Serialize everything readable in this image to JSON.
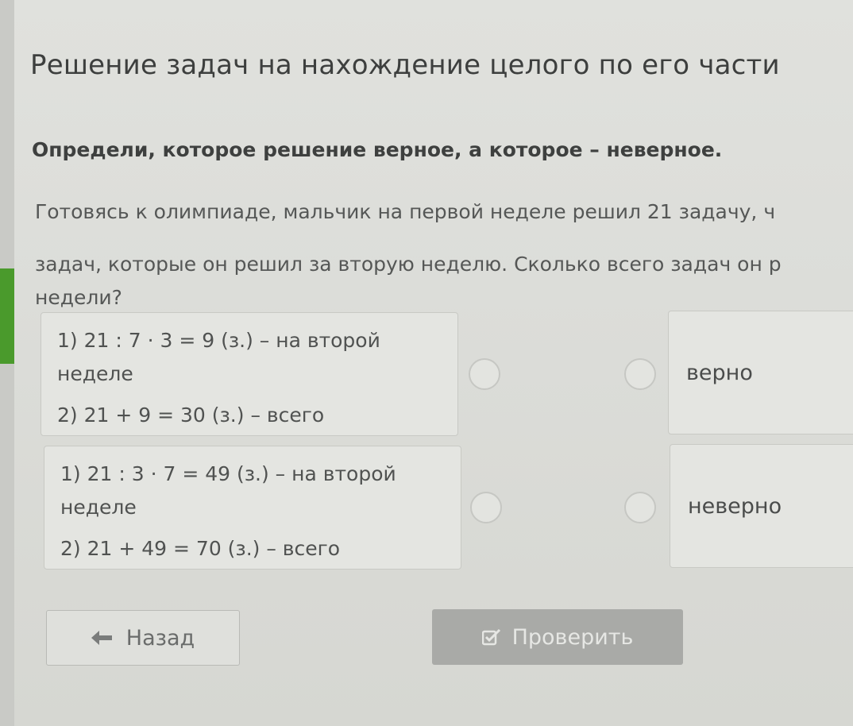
{
  "lesson": {
    "title": "Решение задач на нахождение целого по его части"
  },
  "task": {
    "instruction": "Определи, которое решение верное, а которое – неверное.",
    "problem_lines": [
      "Готовясь к олимпиаде, мальчик на первой неделе решил 21 задачу, ч",
      "задач, которые он решил за вторую неделю. Сколько всего задач он р",
      "недели?"
    ]
  },
  "solutions": [
    {
      "lines": [
        "1) 21 : 7 · 3 = 9 (з.) – на второй",
        "неделе",
        "2) 21 + 9 = 30 (з.) – всего"
      ]
    },
    {
      "lines": [
        "1) 21 : 3 · 7 = 49 (з.) – на второй",
        "неделе",
        "2) 21 + 49 = 70 (з.) – всего"
      ]
    }
  ],
  "answers": [
    {
      "label": "верно"
    },
    {
      "label": "неверно"
    }
  ],
  "buttons": {
    "back_label": "Назад",
    "check_label": "Проверить"
  },
  "icons": {
    "back": "arrow-left-icon",
    "check": "check-square-icon"
  },
  "colors": {
    "accent": "#4a9a2c",
    "check_button": "#a9aaa7"
  }
}
